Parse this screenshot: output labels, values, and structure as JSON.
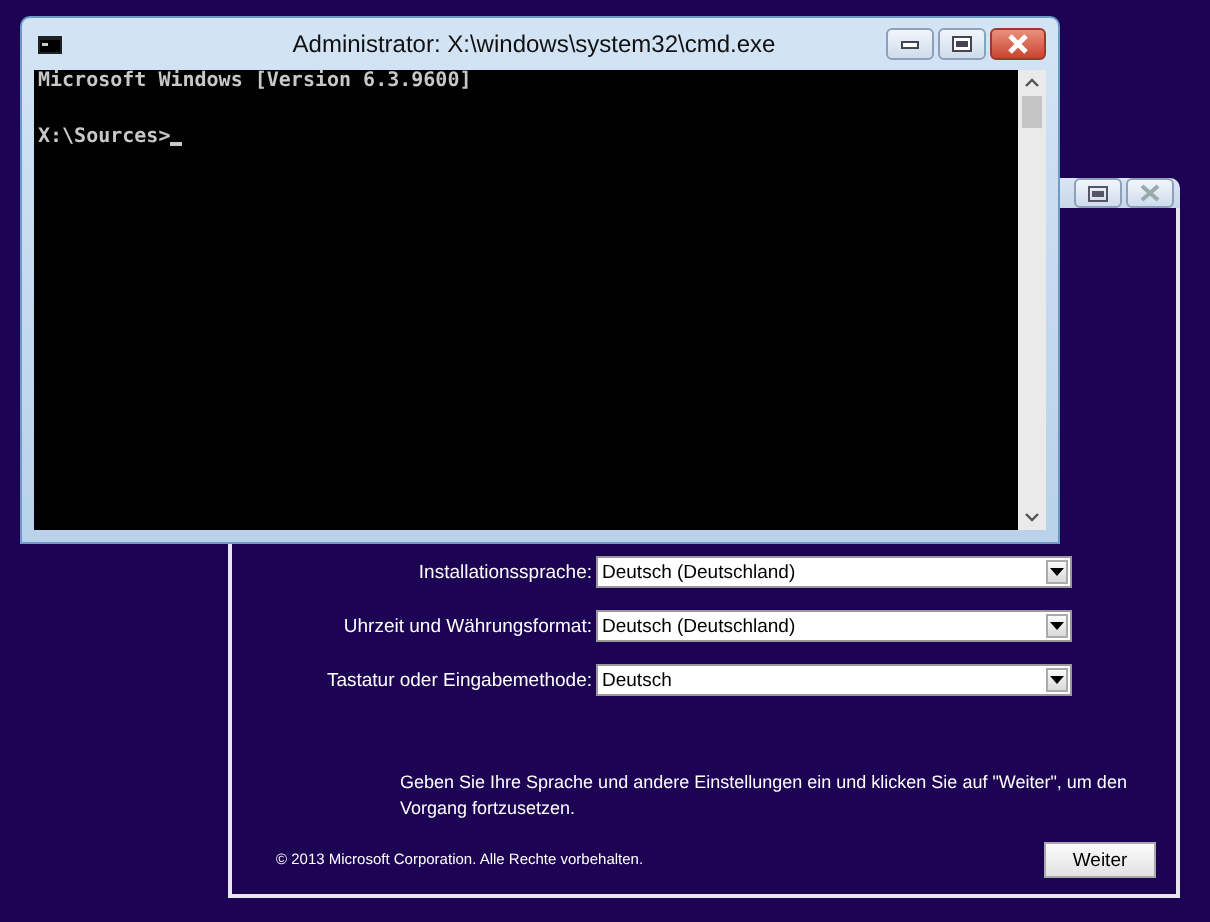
{
  "cmd_window": {
    "title": "Administrator: X:\\windows\\system32\\cmd.exe",
    "lines": [
      "Microsoft Windows [Version 6.3.9600]"
    ],
    "prompt": "X:\\Sources>"
  },
  "setup_window": {
    "fields": [
      {
        "label": "Installationssprache:",
        "value": "Deutsch (Deutschland)"
      },
      {
        "label": "Uhrzeit und Währungsformat:",
        "value": "Deutsch (Deutschland)"
      },
      {
        "label": "Tastatur oder Eingabemethode:",
        "value": "Deutsch"
      }
    ],
    "hint": "Geben Sie Ihre Sprache und andere Einstellungen ein und klicken Sie auf \"Weiter\", um den Vorgang fortzusetzen.",
    "copyright": "© 2013 Microsoft Corporation. Alle Rechte vorbehalten.",
    "next_button": "Weiter"
  }
}
